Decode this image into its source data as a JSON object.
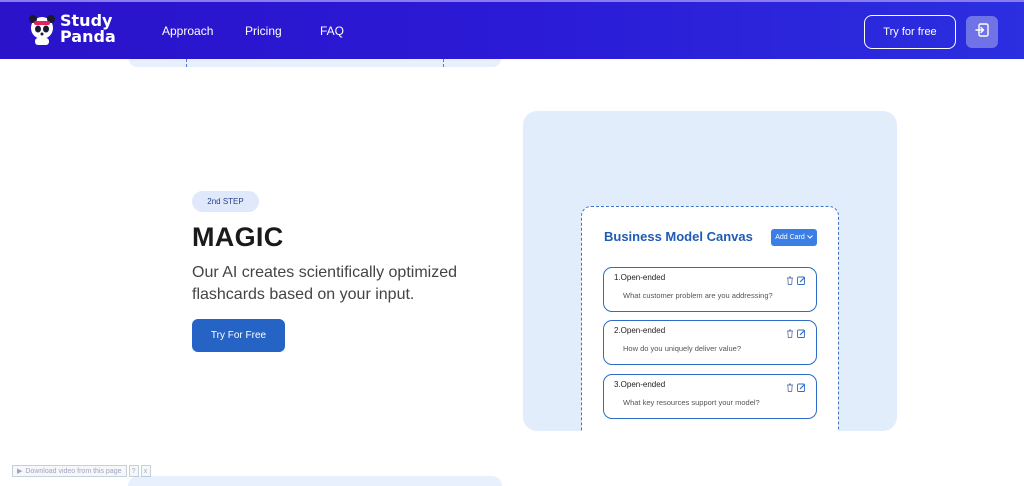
{
  "brand": {
    "line1": "Study",
    "line2": "Panda"
  },
  "nav": {
    "items": [
      "Approach",
      "Pricing",
      "FAQ"
    ]
  },
  "header": {
    "try_label": "Try for free",
    "login_icon": "login-icon"
  },
  "step": {
    "badge": "2nd STEP",
    "title": "MAGIC",
    "description": "Our AI creates scientifically optimized flashcards based on your input.",
    "cta": "Try For Free"
  },
  "canvas": {
    "title": "Business Model Canvas",
    "add_card": "Add Card",
    "cards": [
      {
        "label": "1.Open-ended",
        "text": "What customer problem are you addressing?"
      },
      {
        "label": "2.Open-ended",
        "text": "How do you uniquely deliver value?"
      },
      {
        "label": "3.Open-ended",
        "text": "What key resources support your model?"
      }
    ]
  },
  "download": {
    "label": "Download video from this page",
    "help": "?",
    "close": "x"
  },
  "colors": {
    "header": "#2b1ad6",
    "accent": "#2563c4",
    "panel": "#e2edfc"
  }
}
